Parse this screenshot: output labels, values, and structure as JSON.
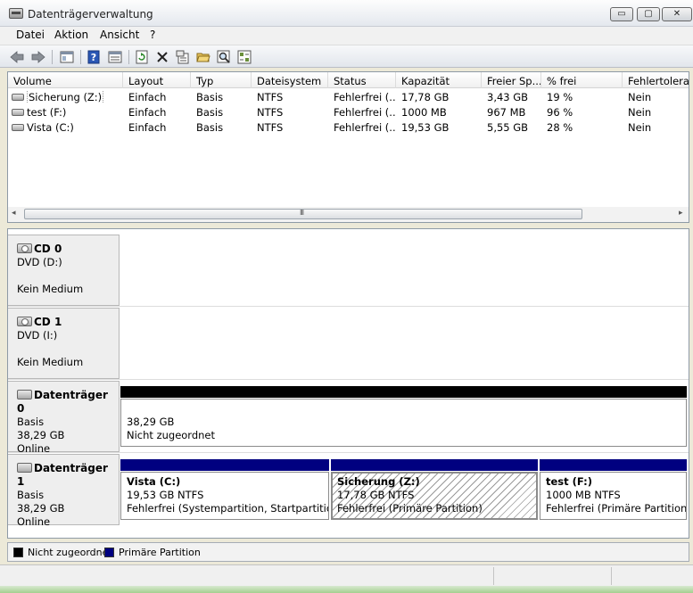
{
  "window": {
    "title": "Datenträgerverwaltung",
    "minimize": "▭",
    "maximize": "▢",
    "close": "✕"
  },
  "menu": [
    "Datei",
    "Aktion",
    "Ansicht",
    "?"
  ],
  "toolbar": {
    "icons": [
      "back-arrow-icon",
      "forward-arrow-icon",
      "console-tree-icon",
      "help-icon",
      "properties-view-icon",
      "refresh-icon",
      "delete-icon",
      "properties-icon",
      "open-folder-icon",
      "search-icon",
      "settings-icon"
    ]
  },
  "volume_list": {
    "columns": [
      "Volume",
      "Layout",
      "Typ",
      "Dateisystem",
      "Status",
      "Kapazität",
      "Freier Sp...",
      "% frei",
      "Fehlertoleranz"
    ],
    "rows": [
      [
        "Sicherung (Z:)",
        "Einfach",
        "Basis",
        "NTFS",
        "Fehlerfrei (...",
        "17,78 GB",
        "3,43 GB",
        "19 %",
        "Nein"
      ],
      [
        "test (F:)",
        "Einfach",
        "Basis",
        "NTFS",
        "Fehlerfrei (...",
        "1000 MB",
        "967 MB",
        "96 %",
        "Nein"
      ],
      [
        "Vista (C:)",
        "Einfach",
        "Basis",
        "NTFS",
        "Fehlerfrei (...",
        "19,53 GB",
        "5,55 GB",
        "28 %",
        "Nein"
      ]
    ],
    "scroll_left": "◂",
    "scroll_right": "▸",
    "scroll_grip": "III"
  },
  "disks": [
    {
      "name": "CD 0",
      "line1": "DVD (D:)",
      "line2": "",
      "line3": "Kein Medium",
      "kind": "cd"
    },
    {
      "name": "CD 1",
      "line1": "DVD (I:)",
      "line2": "",
      "line3": "Kein Medium",
      "kind": "cd"
    },
    {
      "name": "Datenträger 0",
      "line1": "Basis",
      "line2": "38,29 GB",
      "line3": "Online",
      "kind": "disk",
      "partitions": [
        {
          "title": "",
          "size": "38,29 GB",
          "status": "Nicht zugeordnet",
          "bar_color": "#000000"
        }
      ]
    },
    {
      "name": "Datenträger 1",
      "line1": "Basis",
      "line2": "38,29 GB",
      "line3": "Online",
      "kind": "disk",
      "partitions": [
        {
          "title": "Vista  (C:)",
          "size": "19,53 GB NTFS",
          "status": "Fehlerfrei (Systempartition, Startpartition,",
          "bar_color": "#000080"
        },
        {
          "title": "Sicherung  (Z:)",
          "size": "17,78 GB NTFS",
          "status": "Fehlerfrei (Primäre Partition)",
          "bar_color": "#000080",
          "selected": true
        },
        {
          "title": "test  (F:)",
          "size": "1000 MB NTFS",
          "status": "Fehlerfrei (Primäre Partition)",
          "bar_color": "#000080"
        }
      ]
    }
  ],
  "legend": [
    {
      "label": "Nicht zugeordnet",
      "color": "#000000"
    },
    {
      "label": "Primäre Partition",
      "color": "#000080"
    }
  ]
}
